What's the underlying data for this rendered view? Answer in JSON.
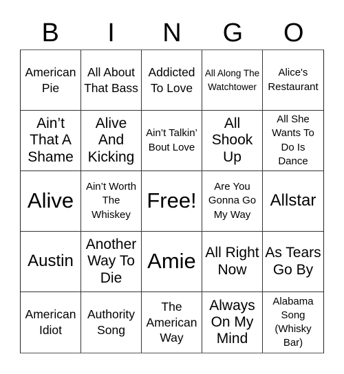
{
  "header": {
    "letters": [
      "B",
      "I",
      "N",
      "G",
      "O"
    ]
  },
  "board": {
    "rows": [
      [
        "American Pie",
        "All About That Bass",
        "Addicted To Love",
        "All Along The Watchtower",
        "Alice's Restaurant"
      ],
      [
        "Ain’t That A Shame",
        "Alive And Kicking",
        "Ain’t Talkin’ Bout Love",
        "All Shook Up",
        "All She Wants To Do Is Dance"
      ],
      [
        "Alive",
        "Ain’t Worth The Whiskey",
        "Free!",
        "Are You Gonna Go My Way",
        "Allstar"
      ],
      [
        "Austin",
        "Another Way To Die",
        "Amie",
        "All Right Now",
        "As Tears Go By"
      ],
      [
        "American Idiot",
        "Authority Song",
        "The American Way",
        "Always On My Mind",
        "Alabama Song (Whisky Bar)"
      ]
    ],
    "free_space": "Free!"
  },
  "colors": {
    "background": "#ffffff",
    "text": "#000000",
    "grid_line": "#333333"
  }
}
